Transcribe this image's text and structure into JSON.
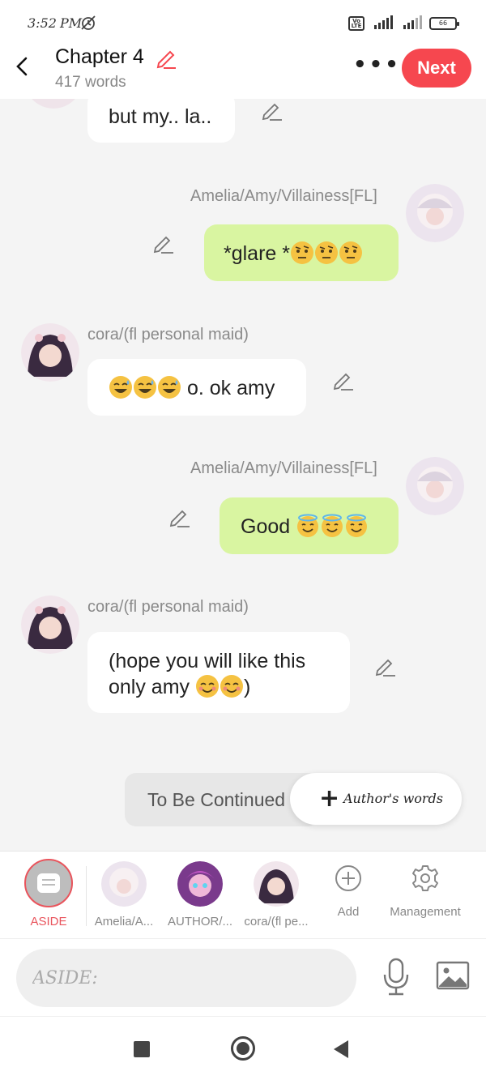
{
  "status_bar": {
    "time": "3:52",
    "ampm": "PM",
    "battery": "66",
    "volte": "Vo LTE"
  },
  "header": {
    "title": "Chapter 4",
    "word_count": "417 words",
    "more": "•••",
    "next_label": "Next"
  },
  "messages": [
    {
      "side": "left",
      "name": "",
      "text": "but my.. la..",
      "emojis": []
    },
    {
      "side": "right",
      "name": "Amelia/Amy/Villainess[FL]",
      "text": "*glare *",
      "emojis": [
        "raised-eyebrow",
        "raised-eyebrow",
        "raised-eyebrow"
      ]
    },
    {
      "side": "left",
      "name": "cora/(fl personal maid)",
      "text": " o. ok amy",
      "emojis": [
        "sweat-smile",
        "sweat-smile",
        "sweat-smile"
      ]
    },
    {
      "side": "right",
      "name": "Amelia/Amy/Villainess[FL]",
      "text": "Good ",
      "emojis": [
        "halo",
        "halo",
        "halo"
      ]
    },
    {
      "side": "left",
      "name": "cora/(fl personal maid)",
      "text_line1": "(hope you will like this",
      "text_line2": "only amy ",
      "text_after": ")",
      "emojis": [
        "smile-blush",
        "smile-blush"
      ]
    }
  ],
  "footer_actions": {
    "to_be_continued": "To Be Continued",
    "author_words": "Author's words"
  },
  "tray": {
    "aside": "ASIDE",
    "characters": [
      "Amelia/A...",
      "AUTHOR/...",
      "cora/(fl pe..."
    ],
    "add": "Add",
    "management": "Management"
  },
  "input": {
    "placeholder": "ASIDE:"
  },
  "colors": {
    "accent": "#f6474f",
    "right_bubble": "#d9f5a1",
    "left_bubble": "#ffffff",
    "background": "#f4f4f4"
  }
}
